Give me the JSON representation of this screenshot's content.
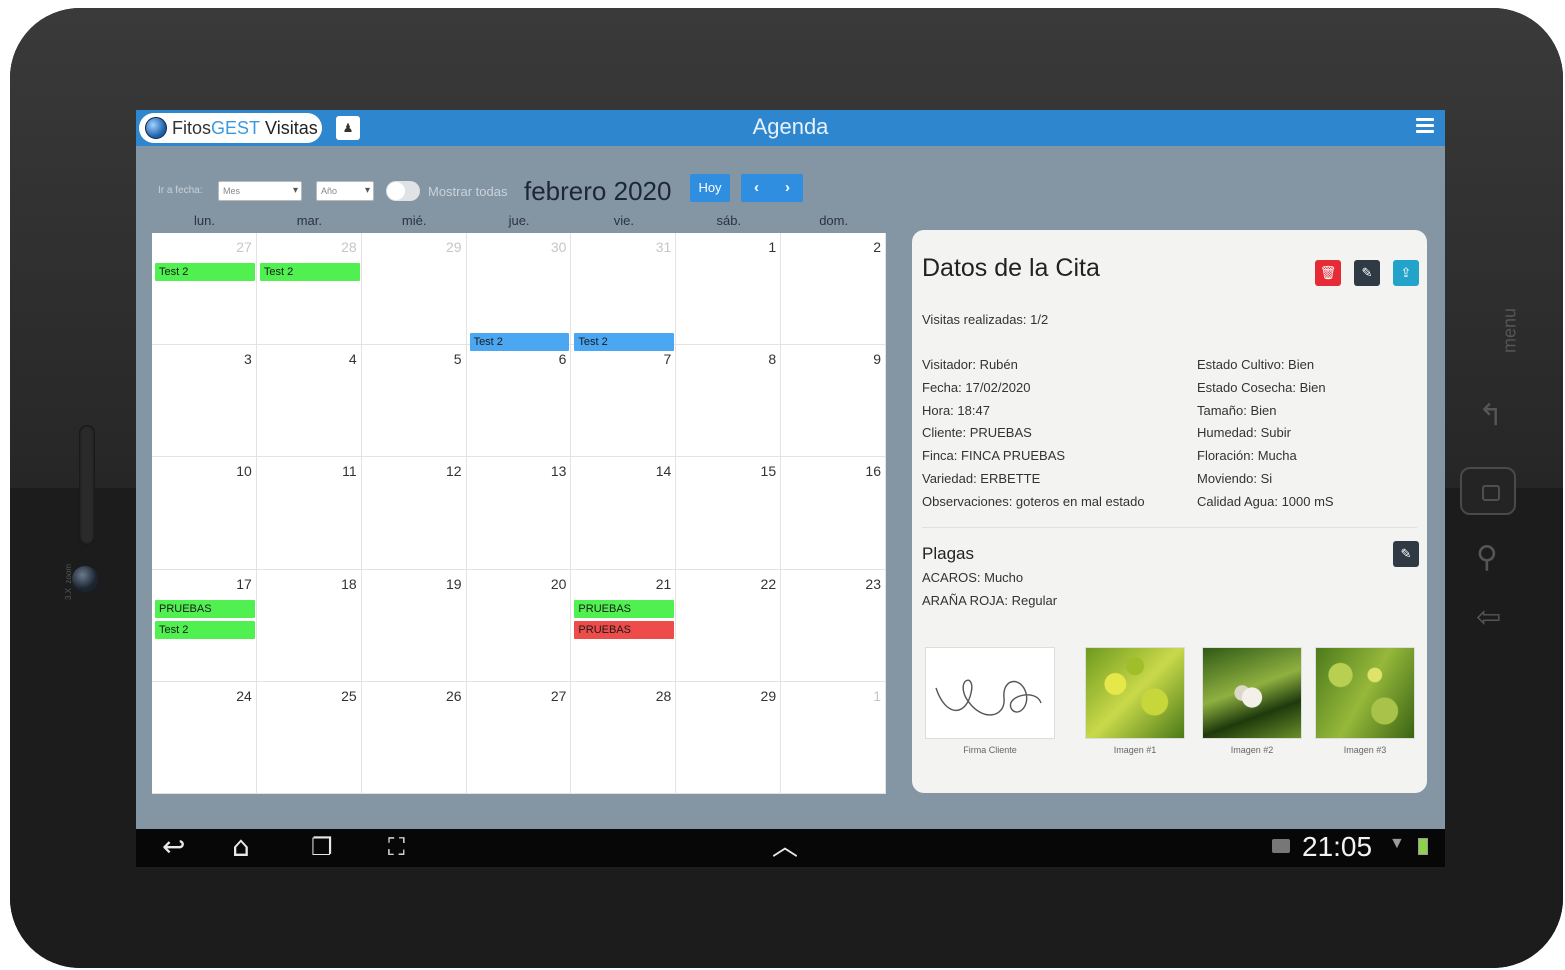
{
  "app": {
    "logo_part1": "Fitos",
    "logo_part2": "GEST",
    "logo_part3": "Visitas",
    "title": "Agenda",
    "user_icon": "person-icon",
    "menu_icon": "hamburger-icon",
    "accent": "#2e86cf"
  },
  "toolbar": {
    "goto_label": "Ir a fecha:",
    "month_placeholder": "Mes",
    "year_placeholder": "Año",
    "show_all_label": "Mostrar todas",
    "show_all_on": false,
    "month_title": "febrero 2020",
    "today_label": "Hoy",
    "prev_label": "‹",
    "next_label": "›"
  },
  "calendar": {
    "days_of_week": [
      "lun.",
      "mar.",
      "mié.",
      "jue.",
      "vie.",
      "sáb.",
      "dom."
    ],
    "weeks": [
      [
        {
          "d": "27",
          "out": true
        },
        {
          "d": "28",
          "out": true
        },
        {
          "d": "29",
          "out": true
        },
        {
          "d": "30",
          "out": true
        },
        {
          "d": "31",
          "out": true
        },
        {
          "d": "1"
        },
        {
          "d": "2"
        }
      ],
      [
        {
          "d": "3"
        },
        {
          "d": "4"
        },
        {
          "d": "5"
        },
        {
          "d": "6"
        },
        {
          "d": "7"
        },
        {
          "d": "8"
        },
        {
          "d": "9"
        }
      ],
      [
        {
          "d": "10"
        },
        {
          "d": "11"
        },
        {
          "d": "12"
        },
        {
          "d": "13"
        },
        {
          "d": "14"
        },
        {
          "d": "15"
        },
        {
          "d": "16"
        }
      ],
      [
        {
          "d": "17"
        },
        {
          "d": "18"
        },
        {
          "d": "19"
        },
        {
          "d": "20"
        },
        {
          "d": "21"
        },
        {
          "d": "22"
        },
        {
          "d": "23"
        }
      ],
      [
        {
          "d": "24"
        },
        {
          "d": "25"
        },
        {
          "d": "26"
        },
        {
          "d": "27"
        },
        {
          "d": "28"
        },
        {
          "d": "29"
        },
        {
          "d": "1",
          "out": true
        }
      ]
    ],
    "events": [
      {
        "label": "Test 2",
        "color": "green",
        "week": 0,
        "day": 0,
        "slot": 0
      },
      {
        "label": "Test 2",
        "color": "green",
        "week": 0,
        "day": 1,
        "slot": 0
      },
      {
        "label": "Test 2",
        "color": "blue",
        "week": 0,
        "day": 3,
        "slot": "bottom"
      },
      {
        "label": "Test 2",
        "color": "blue",
        "week": 0,
        "day": 4,
        "slot": "bottom"
      },
      {
        "label": "PRUEBAS",
        "color": "green",
        "week": 3,
        "day": 0,
        "slot": 0
      },
      {
        "label": "Test 2",
        "color": "green",
        "week": 3,
        "day": 0,
        "slot": 1
      },
      {
        "label": "PRUEBAS",
        "color": "green",
        "week": 3,
        "day": 4,
        "slot": 0
      },
      {
        "label": "PRUEBAS",
        "color": "red",
        "week": 3,
        "day": 4,
        "slot": 1
      }
    ],
    "event_colors": {
      "green": "#4ff04f",
      "blue": "#4ba7f2",
      "red": "#ee4b4b"
    }
  },
  "details": {
    "title": "Datos de la Cita",
    "delete_icon": "trash-icon",
    "edit_icon": "pencil-icon",
    "upload_icon": "upload-icon",
    "visits": "Visitas realizadas: 1/2",
    "left": [
      "Visitador: Rubén",
      "Fecha: 17/02/2020",
      "Hora: 18:47",
      "Cliente: PRUEBAS",
      "Finca: FINCA PRUEBAS",
      "Variedad: ERBETTE",
      "Observaciones: goteros en mal estado"
    ],
    "right": [
      "Estado Cultivo: Bien",
      "Estado Cosecha: Bien",
      "Tamaño: Bien",
      "Humedad: Subir",
      "Floración: Mucha",
      "Moviendo: Si",
      "Calidad Agua: 1000 mS"
    ],
    "plagas_title": "Plagas",
    "plagas": [
      "ACAROS: Mucho",
      "ARAÑA ROJA: Regular"
    ],
    "images": [
      {
        "caption": "Firma Cliente"
      },
      {
        "caption": "Imagen #1"
      },
      {
        "caption": "Imagen #2"
      },
      {
        "caption": "Imagen #3"
      }
    ]
  },
  "system": {
    "time": "21:05",
    "back_icon": "back-icon",
    "home_icon": "home-icon",
    "recents_icon": "recents-icon",
    "screenshot_icon": "screenshot-icon",
    "up_icon": "chevron-up-icon",
    "wifi_icon": "wifi-icon",
    "battery_icon": "battery-icon"
  },
  "device": {
    "brand": "3.X",
    "brand_sub": "zoom",
    "menu_label": "menu"
  }
}
